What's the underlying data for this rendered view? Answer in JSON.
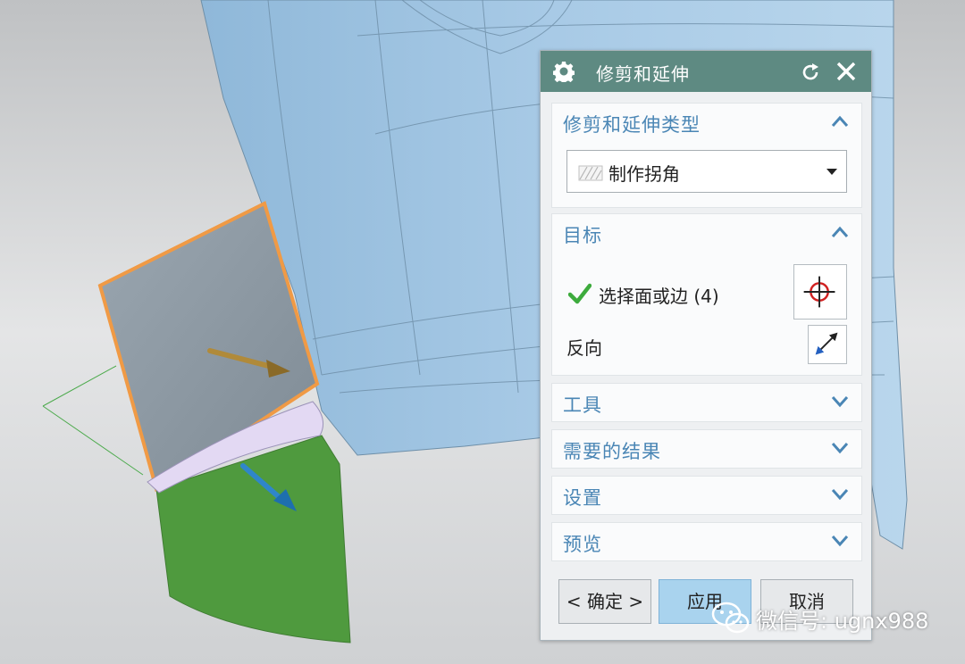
{
  "dialog": {
    "title": "修剪和延伸",
    "sections": {
      "type": {
        "title": "修剪和延伸类型",
        "selected": "制作拐角"
      },
      "target": {
        "title": "目标",
        "select_label": "选择面或边 (4)",
        "reverse_label": "反向"
      },
      "tools": {
        "title": "工具"
      },
      "result": {
        "title": "需要的结果"
      },
      "settings": {
        "title": "设置"
      },
      "preview": {
        "title": "预览"
      }
    },
    "buttons": {
      "ok": "< 确定 >",
      "apply": "应用",
      "cancel": "取消"
    }
  },
  "watermark": {
    "text": "微信号: ugnx988"
  },
  "colors": {
    "titlebar": "#5e8a82",
    "section_title": "#4a86b5",
    "model_body": "#a9cbe6",
    "green_face": "#4f9a3e",
    "orange_edge": "#f0a050"
  },
  "icons": [
    "gear-icon",
    "reset-icon",
    "close-icon",
    "chevron-up-icon",
    "chevron-down-icon",
    "hatch-icon",
    "check-icon",
    "crosshair-icon",
    "reverse-direction-icon",
    "wechat-icon"
  ]
}
